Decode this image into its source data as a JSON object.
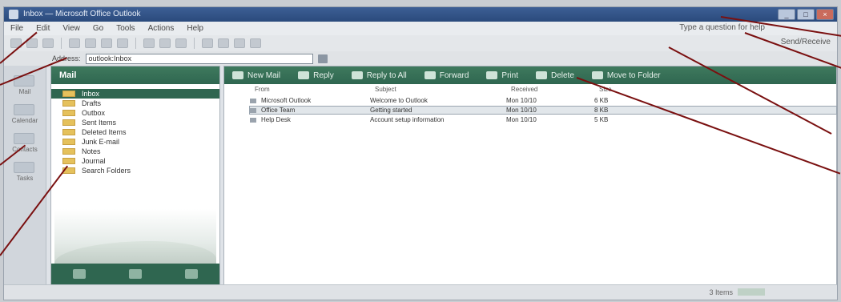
{
  "window": {
    "title": "Inbox — Microsoft Office Outlook",
    "controls": [
      "_",
      "□",
      "×"
    ]
  },
  "menubar": {
    "items": [
      "File",
      "Edit",
      "View",
      "Go",
      "Tools",
      "Actions",
      "Help"
    ],
    "help_box": "Type a question for help"
  },
  "toolbar": {
    "right_label": "Send/Receive"
  },
  "addressbar": {
    "label": "Address:",
    "value": "outlook:Inbox"
  },
  "leftrail": {
    "captions": [
      "Mail",
      "Calendar",
      "Contacts",
      "Tasks"
    ]
  },
  "sidebar": {
    "header": "Mail",
    "folders": [
      {
        "label": "Inbox",
        "selected": true
      },
      {
        "label": "Drafts",
        "selected": false
      },
      {
        "label": "Outbox",
        "selected": false
      },
      {
        "label": "Sent Items",
        "selected": false
      },
      {
        "label": "Deleted Items",
        "selected": false
      },
      {
        "label": "Junk E-mail",
        "selected": false
      },
      {
        "label": "Notes",
        "selected": false
      },
      {
        "label": "Journal",
        "selected": false
      },
      {
        "label": "Search Folders",
        "selected": false
      }
    ]
  },
  "action_bar": {
    "items": [
      "New Mail",
      "Reply",
      "Reply to All",
      "Forward",
      "Print",
      "Delete",
      "Move to Folder"
    ]
  },
  "grid": {
    "columns": [
      "From",
      "Subject",
      "Received",
      "Size"
    ],
    "rows": [
      {
        "from": "Microsoft Outlook",
        "subject": "Welcome to Outlook",
        "received": "Mon 10/10",
        "size": "6 KB"
      },
      {
        "from": "Office Team",
        "subject": "Getting started",
        "received": "Mon 10/10",
        "size": "8 KB"
      },
      {
        "from": "Help Desk",
        "subject": "Account setup information",
        "received": "Mon 10/10",
        "size": "5 KB"
      }
    ]
  },
  "status": {
    "text": "3 Items"
  },
  "colors": {
    "accent": "#2f6650",
    "titlebar": "#2b4a7c",
    "annotation_arrow": "#7a1010"
  }
}
